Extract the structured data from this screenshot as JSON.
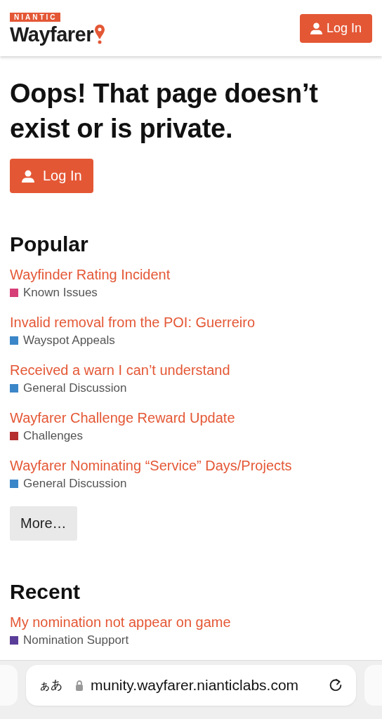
{
  "header": {
    "brand_badge": "NIANTIC",
    "brand_name": "Wayfarer",
    "login_button": "Log In"
  },
  "error": {
    "title": "Oops! That page doesn’t exist or is private.",
    "login_button": "Log In"
  },
  "popular": {
    "heading": "Popular",
    "topics": [
      {
        "title": "Wayfinder Rating Incident",
        "category": "Known Issues",
        "color": "#d63f78"
      },
      {
        "title": "Invalid removal from the POI: Guerreiro",
        "category": "Wayspot Appeals",
        "color": "#3b86c8"
      },
      {
        "title": "Received a warn I can’t understand",
        "category": "General Discussion",
        "color": "#3b86c8"
      },
      {
        "title": "Wayfarer Challenge Reward Update",
        "category": "Challenges",
        "color": "#b5302f"
      },
      {
        "title": "Wayfarer Nominating “Service” Days/Projects",
        "category": "General Discussion",
        "color": "#3b86c8"
      }
    ],
    "more_button": "More…"
  },
  "recent": {
    "heading": "Recent",
    "topics": [
      {
        "title": "My nomination not appear on game",
        "category": "Nomination Support",
        "color": "#5a3d98"
      }
    ]
  },
  "browser_bar": {
    "text_size_button": "ぁあ",
    "url": "munity.wayfarer.nianticlabs.com"
  }
}
